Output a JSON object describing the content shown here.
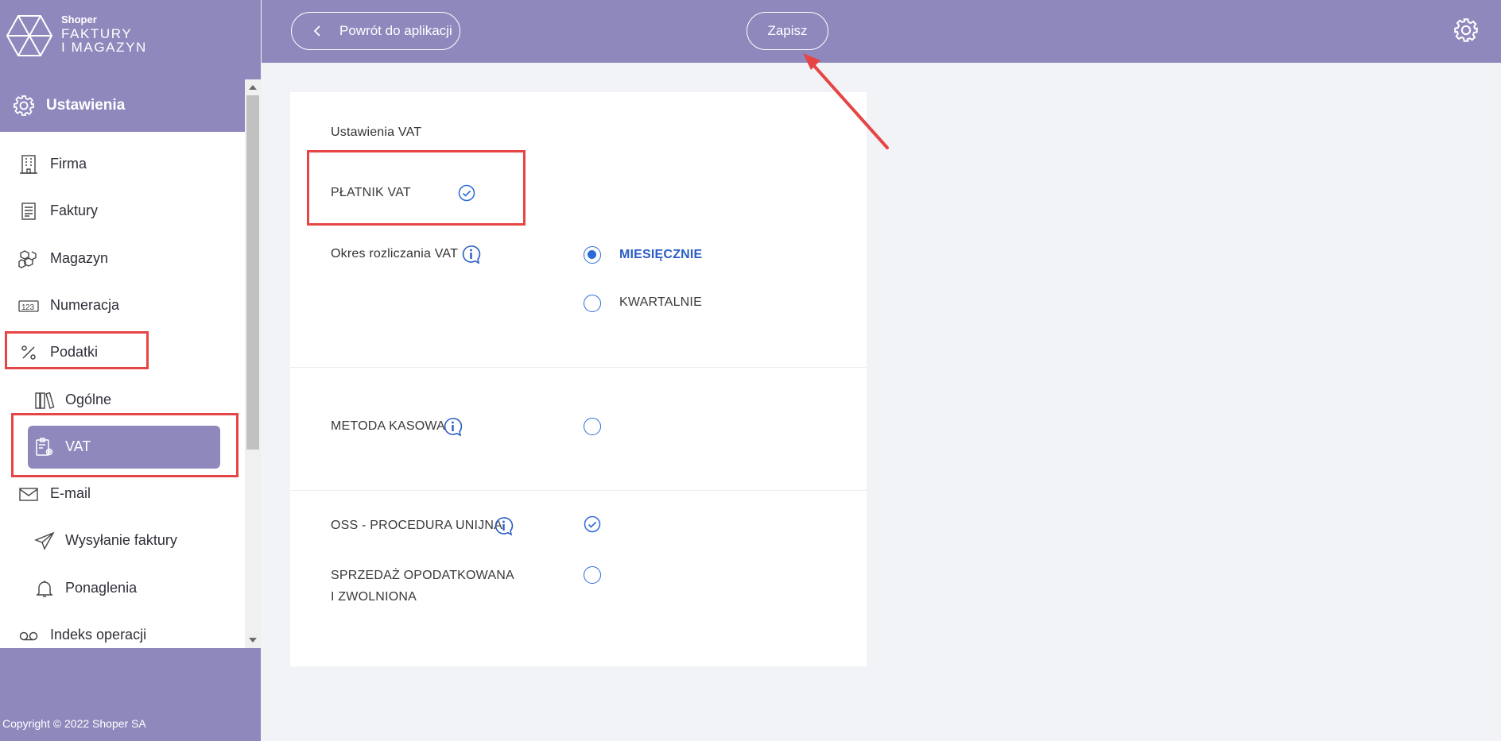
{
  "brand": {
    "small": "Shoper",
    "line1": "FAKTURY",
    "line2": "I MAGAZYN"
  },
  "sidebar": {
    "section_title": "Ustawienia",
    "items": [
      {
        "label": "Firma",
        "icon": "building-icon"
      },
      {
        "label": "Faktury",
        "icon": "invoice-icon"
      },
      {
        "label": "Magazyn",
        "icon": "boxes-icon"
      },
      {
        "label": "Numeracja",
        "icon": "numbering-icon"
      },
      {
        "label": "Podatki",
        "icon": "percent-icon"
      },
      {
        "label": "Ogólne",
        "icon": "books-icon"
      },
      {
        "label": "VAT",
        "icon": "clipboard-gear-icon",
        "active": true
      },
      {
        "label": "E-mail",
        "icon": "envelope-icon"
      },
      {
        "label": "Wysyłanie faktury",
        "icon": "paper-plane-icon"
      },
      {
        "label": "Ponaglenia",
        "icon": "bell-icon"
      },
      {
        "label": "Indeks operacji",
        "icon": "voicemail-icon"
      }
    ],
    "footer": "Copyright © 2022 Shoper SA"
  },
  "topbar": {
    "back_label": "Powrót do aplikacji",
    "save_label": "Zapisz"
  },
  "vat_settings": {
    "heading": "Ustawienia VAT",
    "platnik_label": "PŁATNIK VAT",
    "platnik_checked": true,
    "okres_label": "Okres rozliczania VAT",
    "okres_options": [
      {
        "label": "MIESIĘCZNIE",
        "selected": true
      },
      {
        "label": "KWARTALNIE",
        "selected": false
      }
    ],
    "metoda_label": "METODA KASOWA",
    "metoda_checked": false,
    "oss_label": "OSS - PROCEDURA UNIJNA",
    "oss_checked": true,
    "sprzedaz_line1": "SPRZEDAŻ OPODATKOWANA",
    "sprzedaz_line2": "I ZWOLNIONA",
    "sprzedaz_checked": false
  },
  "colors": {
    "accent": "#8f88bd",
    "link_blue": "#2a5ec4",
    "annotation_red": "#e64545"
  }
}
